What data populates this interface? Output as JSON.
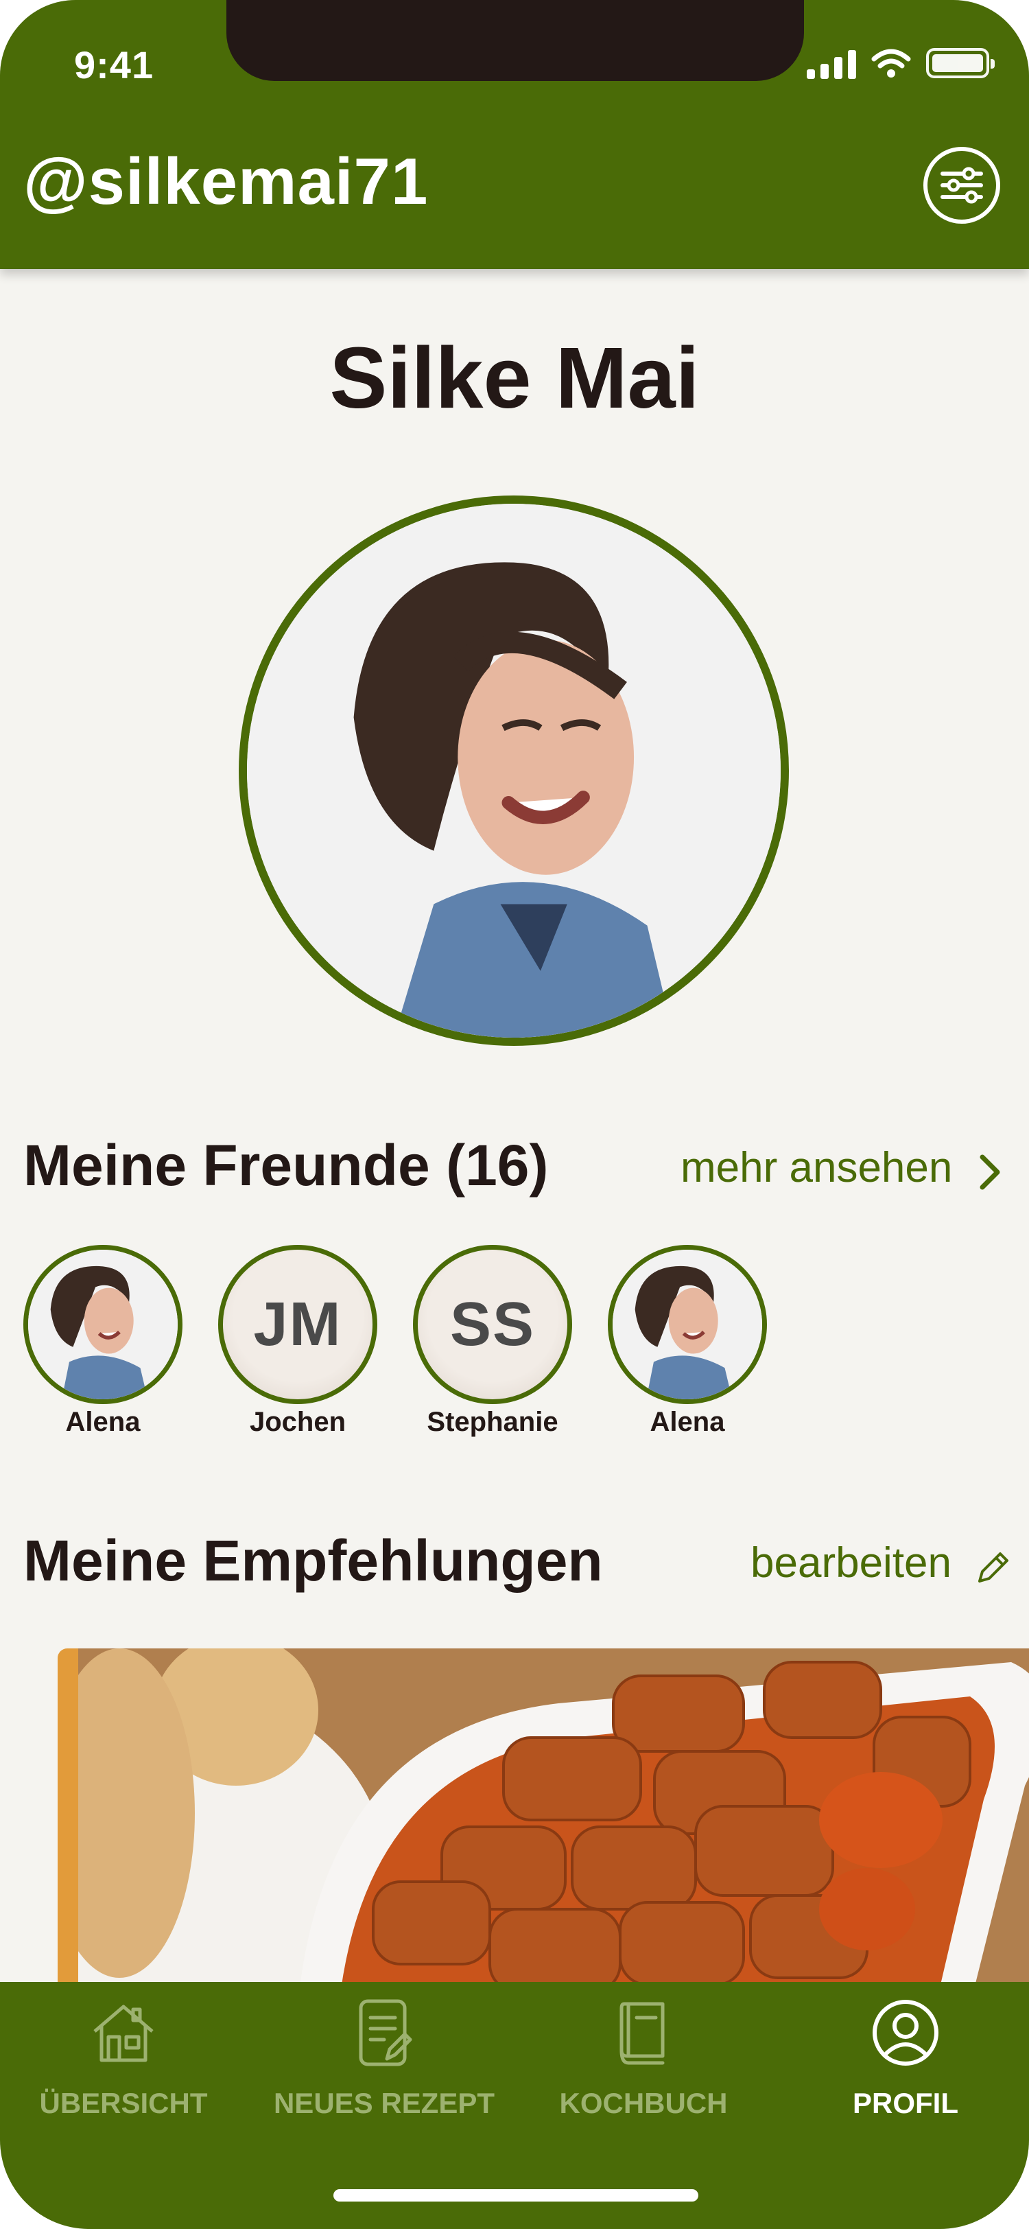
{
  "status_bar": {
    "time": "9:41"
  },
  "header": {
    "handle": "@silkemai71",
    "filter_icon": "sliders-icon"
  },
  "profile": {
    "name": "Silke Mai"
  },
  "friends": {
    "title": "Meine Freunde (16)",
    "more_link": "mehr ansehen",
    "items": [
      {
        "name": "Alena",
        "type": "photo"
      },
      {
        "name": "Jochen",
        "type": "initials",
        "initials": "JM"
      },
      {
        "name": "Stephanie",
        "type": "initials",
        "initials": "SS"
      },
      {
        "name": "Alena",
        "type": "photo"
      }
    ]
  },
  "recommendations": {
    "title": "Meine Empfehlungen",
    "edit_link": "bearbeiten"
  },
  "tabbar": {
    "items": [
      {
        "label": "ÜBERSICHT",
        "icon": "home-icon",
        "active": false
      },
      {
        "label": "NEUES REZEPT",
        "icon": "document-edit-icon",
        "active": false
      },
      {
        "label": "KOCHBUCH",
        "icon": "book-icon",
        "active": false
      },
      {
        "label": "PROFIL",
        "icon": "user-circle-icon",
        "active": true
      }
    ]
  },
  "colors": {
    "primary": "#4a6b07",
    "background": "#f5f4f0",
    "text": "#231816",
    "inactive_tab": "#9db270",
    "card_accent": "#e29b3a"
  }
}
